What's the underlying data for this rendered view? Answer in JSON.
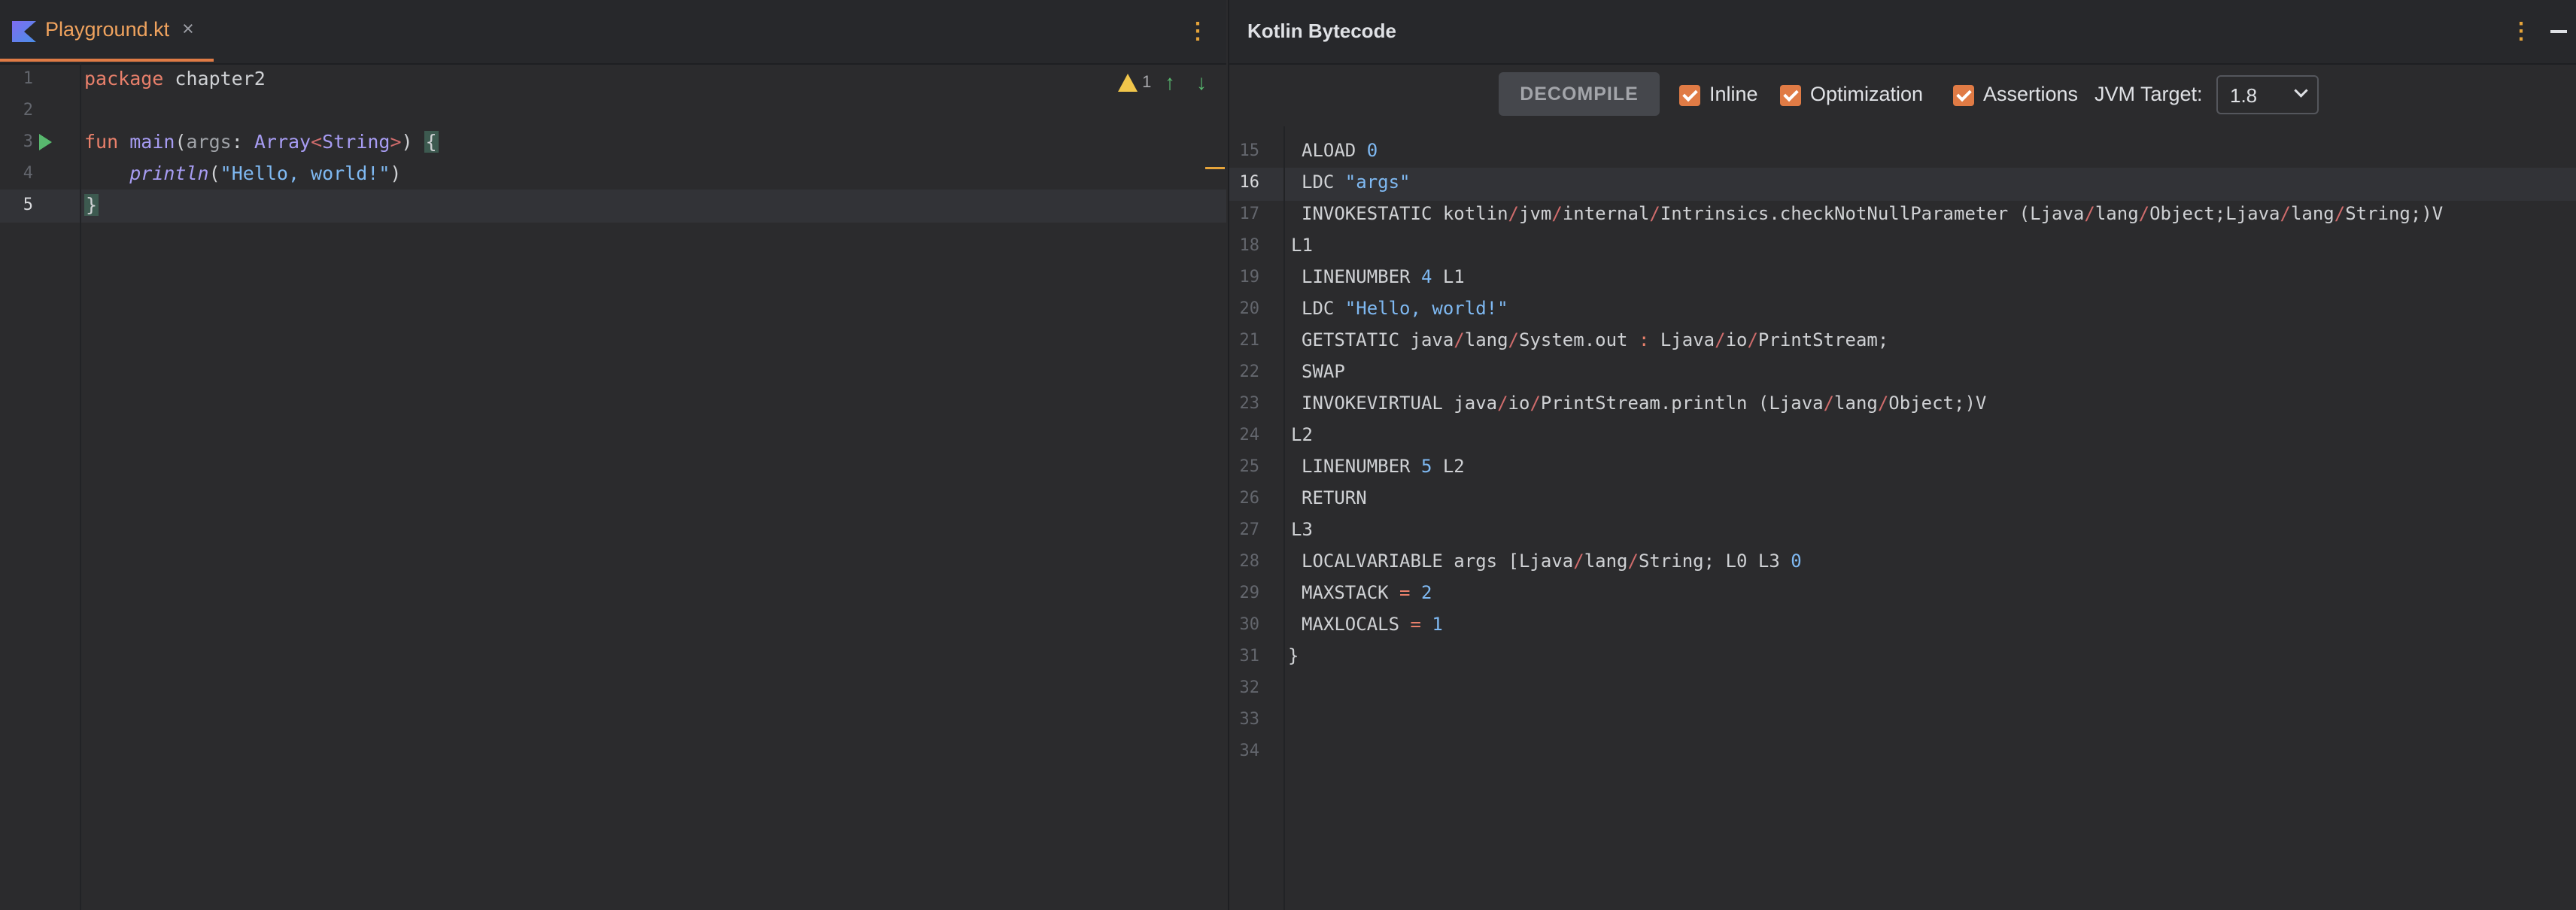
{
  "editor": {
    "tab": {
      "title": "Playground.kt",
      "close": "×"
    },
    "more": "⋮",
    "inspection": {
      "count": "1",
      "up": "↑",
      "down": "↓"
    },
    "line_numbers": [
      "1",
      "2",
      "3",
      "4",
      "5"
    ],
    "code": {
      "l1": {
        "kw": "package",
        "rest": " chapter2"
      },
      "l3": {
        "kw": "fun",
        "name": "main",
        "lp": "(",
        "param": "args",
        "colon": ":",
        "type1": "Array",
        "lt": "<",
        "type2": "String",
        "gt": ">",
        "rp": ")",
        "brace": "{"
      },
      "l4": {
        "indent": "    ",
        "call": "println",
        "lp": "(",
        "str": "\"Hello, world!\"",
        "rp": ")"
      },
      "l5": {
        "brace": "}"
      }
    }
  },
  "bytecode_panel": {
    "title": "Kotlin Bytecode",
    "more": "⋮",
    "decompile_label": "DECOMPILE",
    "options": [
      {
        "label": "Inline",
        "checked": true
      },
      {
        "label": "Optimization",
        "checked": true
      },
      {
        "label": "Assertions",
        "checked": true
      }
    ],
    "jvm_target_label": "JVM Target:",
    "jvm_target_value": "1.8",
    "line_numbers": [
      "15",
      "16",
      "17",
      "18",
      "19",
      "20",
      "21",
      "22",
      "23",
      "24",
      "25",
      "26",
      "27",
      "28",
      "29",
      "30",
      "31",
      "32",
      "33",
      "34"
    ],
    "current_line": "16",
    "lines": [
      [
        {
          "t": "ALOAD "
        },
        {
          "t": "0",
          "c": "num"
        }
      ],
      [
        {
          "t": "LDC "
        },
        {
          "t": "\"args\"",
          "c": "str"
        }
      ],
      [
        {
          "t": "INVOKESTATIC kotlin"
        },
        {
          "t": "/",
          "c": "sl"
        },
        {
          "t": "jvm"
        },
        {
          "t": "/",
          "c": "sl"
        },
        {
          "t": "internal"
        },
        {
          "t": "/",
          "c": "sl"
        },
        {
          "t": "Intrinsics.checkNotNullParameter (Ljava"
        },
        {
          "t": "/",
          "c": "sl"
        },
        {
          "t": "lang"
        },
        {
          "t": "/",
          "c": "sl"
        },
        {
          "t": "Object;Ljava"
        },
        {
          "t": "/",
          "c": "sl"
        },
        {
          "t": "lang"
        },
        {
          "t": "/",
          "c": "sl"
        },
        {
          "t": "String;)V"
        }
      ],
      [
        {
          "t": "L1"
        }
      ],
      [
        {
          "t": "LINENUMBER "
        },
        {
          "t": "4",
          "c": "num"
        },
        {
          "t": " L1"
        }
      ],
      [
        {
          "t": "LDC "
        },
        {
          "t": "\"Hello, world!\"",
          "c": "str"
        }
      ],
      [
        {
          "t": "GETSTATIC java"
        },
        {
          "t": "/",
          "c": "sl"
        },
        {
          "t": "lang"
        },
        {
          "t": "/",
          "c": "sl"
        },
        {
          "t": "System.out "
        },
        {
          "t": ":",
          "c": "op"
        },
        {
          "t": " Ljava"
        },
        {
          "t": "/",
          "c": "sl"
        },
        {
          "t": "io"
        },
        {
          "t": "/",
          "c": "sl"
        },
        {
          "t": "PrintStream;"
        }
      ],
      [
        {
          "t": "SWAP"
        }
      ],
      [
        {
          "t": "INVOKEVIRTUAL java"
        },
        {
          "t": "/",
          "c": "sl"
        },
        {
          "t": "io"
        },
        {
          "t": "/",
          "c": "sl"
        },
        {
          "t": "PrintStream.println (Ljava"
        },
        {
          "t": "/",
          "c": "sl"
        },
        {
          "t": "lang"
        },
        {
          "t": "/",
          "c": "sl"
        },
        {
          "t": "Object;)V"
        }
      ],
      [
        {
          "t": "L2"
        }
      ],
      [
        {
          "t": "LINENUMBER "
        },
        {
          "t": "5",
          "c": "num"
        },
        {
          "t": " L2"
        }
      ],
      [
        {
          "t": "RETURN"
        }
      ],
      [
        {
          "t": "L3"
        }
      ],
      [
        {
          "t": "LOCALVARIABLE args [Ljava"
        },
        {
          "t": "/",
          "c": "sl"
        },
        {
          "t": "lang"
        },
        {
          "t": "/",
          "c": "sl"
        },
        {
          "t": "String; L0 L3 "
        },
        {
          "t": "0",
          "c": "num"
        }
      ],
      [
        {
          "t": "MAXSTACK "
        },
        {
          "t": "=",
          "c": "op"
        },
        {
          "t": " "
        },
        {
          "t": "2",
          "c": "num"
        }
      ],
      [
        {
          "t": "MAXLOCALS "
        },
        {
          "t": "=",
          "c": "op"
        },
        {
          "t": " "
        },
        {
          "t": "1",
          "c": "num"
        }
      ],
      [
        {
          "t": "}"
        }
      ],
      [],
      [],
      []
    ]
  },
  "colors": {
    "accent": "#e07b45",
    "run": "#58b86e",
    "warning": "#f1c64b"
  }
}
